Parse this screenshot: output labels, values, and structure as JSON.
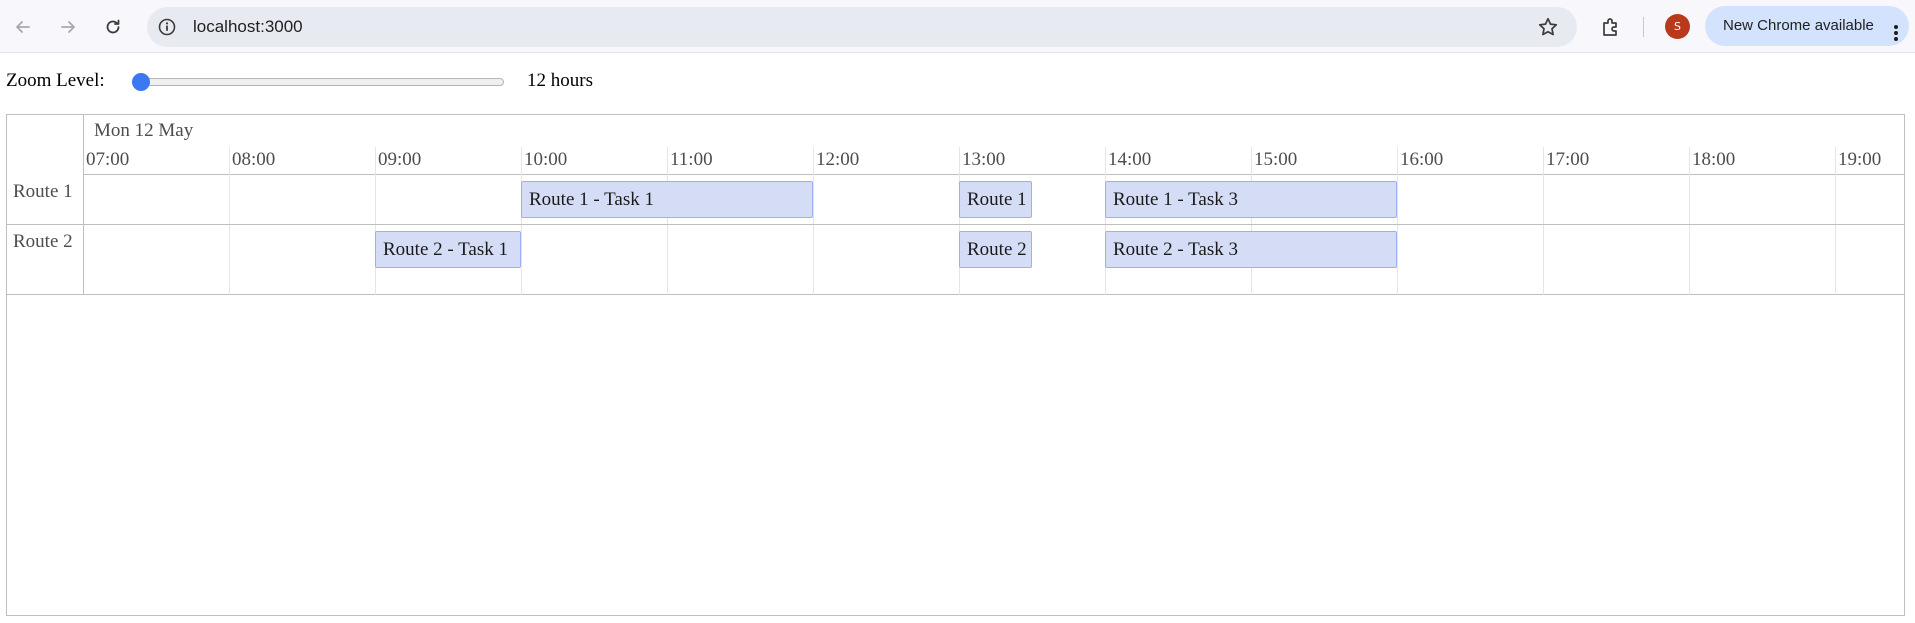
{
  "browser": {
    "url": "localhost:3000",
    "profile_initial": "S",
    "update_label": "New Chrome available",
    "avatar_color": "#b83a1b",
    "update_bg": "#d3e3fd",
    "icons": [
      "back-arrow-icon",
      "forward-arrow-icon",
      "reload-icon",
      "site-info-icon",
      "bookmark-star-icon",
      "extensions-icon",
      "kebab-menu-icon"
    ]
  },
  "zoom": {
    "label": "Zoom Level:",
    "value_label": "12 hours",
    "slider_position": 0
  },
  "timeline": {
    "date_label": "Mon 12 May",
    "hours": [
      "07:00",
      "08:00",
      "09:00",
      "10:00",
      "11:00",
      "12:00",
      "13:00",
      "14:00",
      "15:00",
      "16:00",
      "17:00",
      "18:00",
      "19:00"
    ],
    "groups": [
      {
        "label": "Route 1",
        "items": [
          {
            "label": "Route 1 - Task 1",
            "start": "10:00",
            "end": "12:00"
          },
          {
            "label": "Route 1",
            "start": "13:00",
            "end": "13:30"
          },
          {
            "label": "Route 1 - Task 3",
            "start": "14:00",
            "end": "16:00"
          }
        ]
      },
      {
        "label": "Route 2",
        "items": [
          {
            "label": "Route 2 - Task 1",
            "start": "09:00",
            "end": "10:00"
          },
          {
            "label": "Route 2",
            "start": "13:00",
            "end": "13:30"
          },
          {
            "label": "Route 2 - Task 3",
            "start": "14:00",
            "end": "16:00"
          }
        ]
      }
    ],
    "item_color": "#d5ddf6",
    "item_border_color": "#97b0f8"
  }
}
